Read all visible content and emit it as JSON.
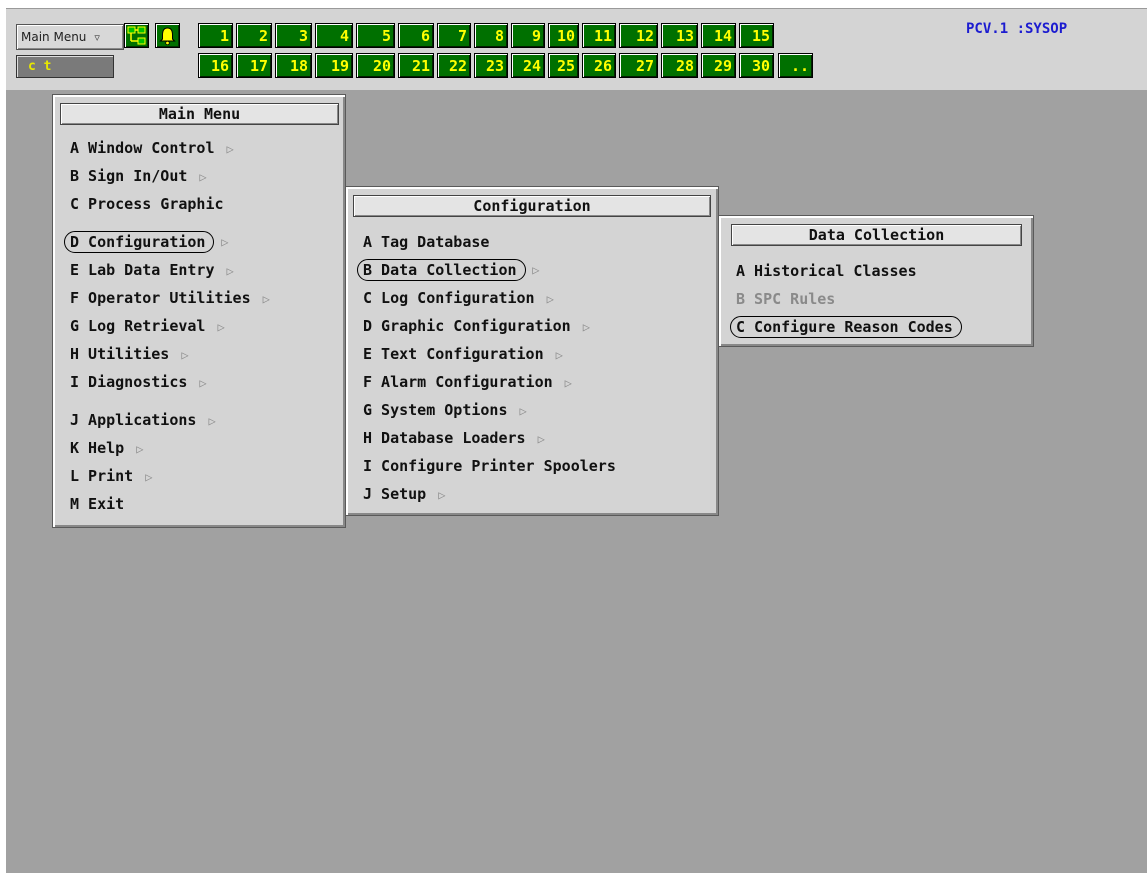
{
  "toolbar": {
    "main_menu_label": "Main Menu",
    "main_menu_arrow": "▿",
    "network_icon": "network-icon",
    "alarm_icon": "bell-icon",
    "command_line": "c t",
    "user_label": "PCV.1 :SYSOP",
    "window_buttons_row1": [
      "1",
      "2",
      "3",
      "4",
      "5",
      "6",
      "7",
      "8",
      "9",
      "10",
      "11",
      "12",
      "13",
      "14",
      "15"
    ],
    "window_buttons_row2": [
      "16",
      "17",
      "18",
      "19",
      "20",
      "21",
      "22",
      "23",
      "24",
      "25",
      "26",
      "27",
      "28",
      "29",
      "30",
      ".."
    ]
  },
  "main_menu": {
    "title": "Main Menu",
    "items": [
      {
        "label": "A Window Control",
        "sub": "▷"
      },
      {
        "label": "B Sign In/Out",
        "sub": "▷"
      },
      {
        "label": "C Process Graphic",
        "sub": ""
      },
      {
        "label": "D Configuration",
        "sub": "▷"
      },
      {
        "label": "E Lab Data Entry",
        "sub": "▷"
      },
      {
        "label": "F Operator Utilities",
        "sub": "▷"
      },
      {
        "label": "G Log Retrieval",
        "sub": "▷"
      },
      {
        "label": "H Utilities",
        "sub": "▷"
      },
      {
        "label": "I Diagnostics",
        "sub": "▷"
      },
      {
        "label": "J Applications",
        "sub": "▷"
      },
      {
        "label": "K Help",
        "sub": "▷"
      },
      {
        "label": "L Print",
        "sub": "▷"
      },
      {
        "label": "M Exit",
        "sub": ""
      }
    ]
  },
  "config_menu": {
    "title": "Configuration",
    "items": [
      {
        "label": "A Tag Database",
        "sub": ""
      },
      {
        "label": "B Data Collection",
        "sub": "▷"
      },
      {
        "label": "C Log Configuration",
        "sub": "▷"
      },
      {
        "label": "D Graphic Configuration",
        "sub": "▷"
      },
      {
        "label": "E Text Configuration",
        "sub": "▷"
      },
      {
        "label": "F Alarm Configuration",
        "sub": "▷"
      },
      {
        "label": "G System Options",
        "sub": "▷"
      },
      {
        "label": "H Database Loaders",
        "sub": "▷"
      },
      {
        "label": "I Configure Printer Spoolers",
        "sub": ""
      },
      {
        "label": "J Setup",
        "sub": "▷"
      }
    ]
  },
  "datacoll_menu": {
    "title": "Data Collection",
    "items": [
      {
        "label": "A Historical Classes",
        "sub": ""
      },
      {
        "label": "B SPC Rules",
        "sub": ""
      },
      {
        "label": "C Configure Reason Codes",
        "sub": ""
      }
    ]
  },
  "colors": {
    "button_green": "#007000",
    "button_text": "#ffff00",
    "workspace": "#a1a1a1",
    "menu_bg": "#d4d4d4",
    "user_label": "#1c1cd0"
  }
}
